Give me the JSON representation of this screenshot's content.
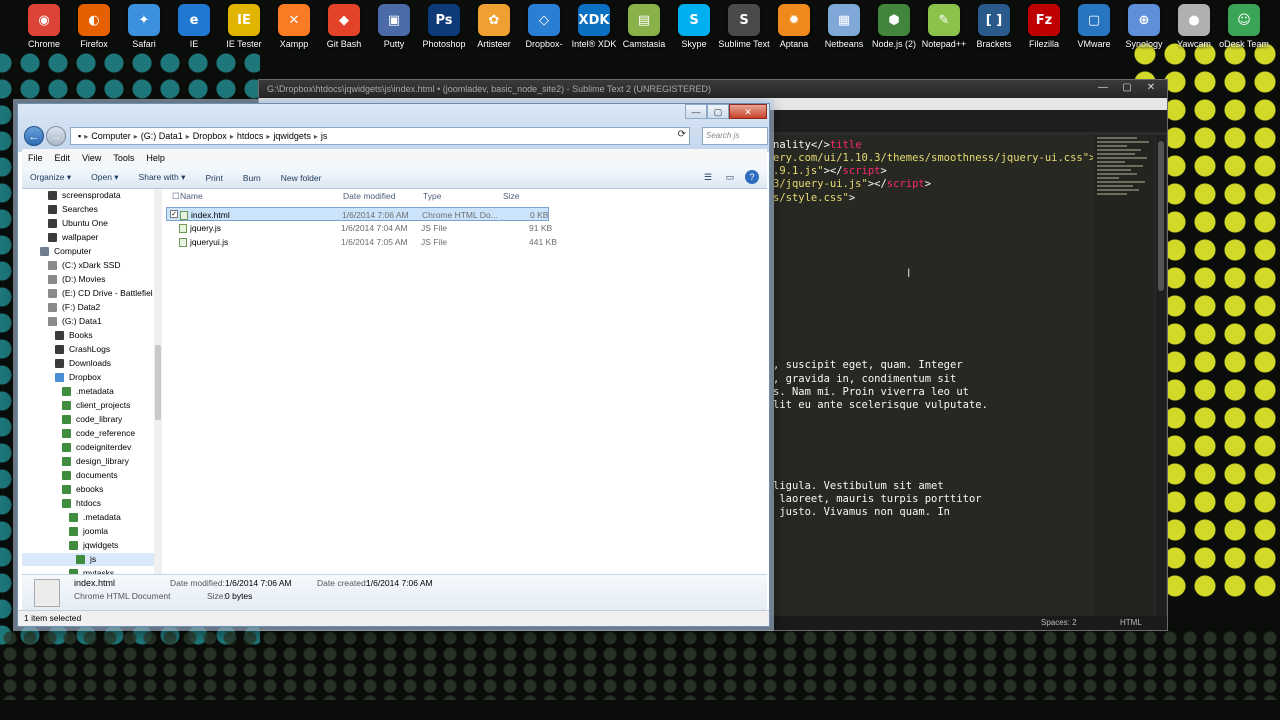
{
  "desktop_icons": [
    {
      "label": "Chrome",
      "icon": "chrome-icon",
      "color": "#db4437",
      "glyph": "◉"
    },
    {
      "label": "Firefox",
      "icon": "firefox-icon",
      "color": "#e66000",
      "glyph": "◐"
    },
    {
      "label": "Safari",
      "icon": "safari-icon",
      "color": "#3d8fe0",
      "glyph": "✦"
    },
    {
      "label": "IE",
      "icon": "ie-icon",
      "color": "#1f78d1",
      "glyph": "e"
    },
    {
      "label": "IE Tester",
      "icon": "ie-tester-icon",
      "color": "#e0b400",
      "glyph": "IE"
    },
    {
      "label": "Xampp",
      "icon": "xampp-icon",
      "color": "#fb7a24",
      "glyph": "✕"
    },
    {
      "label": "Git Bash",
      "icon": "git-bash-icon",
      "color": "#e24329",
      "glyph": "◆"
    },
    {
      "label": "Putty",
      "icon": "putty-icon",
      "color": "#4a6aa8",
      "glyph": "▣"
    },
    {
      "label": "Photoshop",
      "icon": "photoshop-icon",
      "color": "#0f3a78",
      "glyph": "Ps"
    },
    {
      "label": "Artisteer",
      "icon": "artisteer-icon",
      "color": "#f0a030",
      "glyph": "✿"
    },
    {
      "label": "Dropbox-",
      "icon": "dropbox-icon",
      "color": "#2a7fd4",
      "glyph": "◇"
    },
    {
      "label": "Intel® XDK",
      "icon": "intel-xdk-icon",
      "color": "#0b6fc2",
      "glyph": "XDK"
    },
    {
      "label": "Camstasia",
      "icon": "camtasia-icon",
      "color": "#8ab04a",
      "glyph": "▤"
    },
    {
      "label": "Skype",
      "icon": "skype-icon",
      "color": "#00aff0",
      "glyph": "S"
    },
    {
      "label": "Sublime Text",
      "icon": "sublime-icon",
      "color": "#4a4a4a",
      "glyph": "S"
    },
    {
      "label": "Aptana",
      "icon": "aptana-icon",
      "color": "#f08a1c",
      "glyph": "✹"
    },
    {
      "label": "Netbeans",
      "icon": "netbeans-icon",
      "color": "#7fa7d8",
      "glyph": "▦"
    },
    {
      "label": "Node.js (2)",
      "icon": "nodejs-icon",
      "color": "#43853d",
      "glyph": "⬢"
    },
    {
      "label": "Notepad++",
      "icon": "notepadpp-icon",
      "color": "#8bc34a",
      "glyph": "✎"
    },
    {
      "label": "Brackets",
      "icon": "brackets-icon",
      "color": "#2a5a8a",
      "glyph": "[ ]"
    },
    {
      "label": "Filezilla",
      "icon": "filezilla-icon",
      "color": "#bf0000",
      "glyph": "Fz"
    },
    {
      "label": "VMware",
      "icon": "vmware-icon",
      "color": "#2875c2",
      "glyph": "▢"
    },
    {
      "label": "Synology",
      "icon": "synology-icon",
      "color": "#5f8fd6",
      "glyph": "⊕"
    },
    {
      "label": "Yawcam",
      "icon": "yawcam-icon",
      "color": "#b0b0b0",
      "glyph": "●"
    },
    {
      "label": "oDesk Team",
      "icon": "odesk-icon",
      "color": "#3aa655",
      "glyph": "☺"
    }
  ],
  "sublime": {
    "title": "G:\\Dropbox\\htdocs\\jqwidgets\\js\\index.html • (joomladev, basic_node_site2) - Sublime Text 2 (UNREGISTERED)",
    "code_lines": [
      {
        "pre": "nality</",
        "tag": "title",
        "post": ">"
      },
      {
        "pre": "",
        "str": "ery.com/ui/1.10.3/themes/smoothness/jquery-ui.css\">",
        "post": ""
      },
      {
        "pre": "",
        "str": ".9.1.js\"",
        "post": "></",
        "tag": "script",
        "end": ">"
      },
      {
        "pre": "",
        "str": "3/jquery-ui.js\"",
        "post": "></",
        "tag": "script",
        "end": ">"
      },
      {
        "pre": "",
        "str": "s/style.css\"",
        "post": ">"
      },
      {
        "text": ", suscipit eget, quam. Integer"
      },
      {
        "text": ", gravida in, condimentum sit"
      },
      {
        "text": "s. Nam mi. Proin viverra leo ut"
      },
      {
        "text": "lit eu ante scelerisque vulputate."
      },
      {
        "text": "ligula. Vestibulum sit amet"
      },
      {
        "text": " laoreet, mauris turpis porttitor"
      },
      {
        "text": " justo. Vivamus non quam. In"
      }
    ],
    "status_spaces": "Spaces: 2",
    "status_syntax": "HTML"
  },
  "explorer": {
    "breadcrumb": [
      "Computer",
      "(G:) Data1",
      "Dropbox",
      "htdocs",
      "jqwidgets",
      "js"
    ],
    "search_placeholder": "Search js",
    "menu": [
      "File",
      "Edit",
      "View",
      "Tools",
      "Help"
    ],
    "commands": [
      "Organize ▾",
      "Open ▾",
      "Share with ▾",
      "Print",
      "Burn",
      "New folder"
    ],
    "nav_items": [
      {
        "label": "screensprodata",
        "indent": 0,
        "color": "#3b3b3b"
      },
      {
        "label": "Searches",
        "indent": 0,
        "color": "#3b3b3b"
      },
      {
        "label": "Ubuntu One",
        "indent": 0,
        "color": "#3b3b3b"
      },
      {
        "label": "wallpaper",
        "indent": 0,
        "color": "#3b3b3b"
      },
      {
        "label": "Computer",
        "indent": -8,
        "color": "#6f7f90"
      },
      {
        "label": "(C:) xDark SSD",
        "indent": 0,
        "color": "#8a8a8a"
      },
      {
        "label": "(D:) Movies",
        "indent": 0,
        "color": "#8a8a8a"
      },
      {
        "label": "(E:) CD Drive - Battlefiel",
        "indent": 0,
        "color": "#8a8a8a"
      },
      {
        "label": "(F:) Data2",
        "indent": 0,
        "color": "#8a8a8a"
      },
      {
        "label": "(G:) Data1",
        "indent": 0,
        "color": "#8a8a8a"
      },
      {
        "label": "Books",
        "indent": 7,
        "color": "#3b3b3b"
      },
      {
        "label": "CrashLogs",
        "indent": 7,
        "color": "#3b3b3b"
      },
      {
        "label": "Downloads",
        "indent": 7,
        "color": "#3b3b3b"
      },
      {
        "label": "Dropbox",
        "indent": 7,
        "color": "#4a8fd4"
      },
      {
        "label": ".metadata",
        "indent": 14,
        "color": "#3f8c3f"
      },
      {
        "label": "client_projects",
        "indent": 14,
        "color": "#3f8c3f"
      },
      {
        "label": "code_library",
        "indent": 14,
        "color": "#3f8c3f"
      },
      {
        "label": "code_reference",
        "indent": 14,
        "color": "#3f8c3f"
      },
      {
        "label": "codeigniterdev",
        "indent": 14,
        "color": "#3f8c3f"
      },
      {
        "label": "design_library",
        "indent": 14,
        "color": "#3f8c3f"
      },
      {
        "label": "documents",
        "indent": 14,
        "color": "#3f8c3f"
      },
      {
        "label": "ebooks",
        "indent": 14,
        "color": "#3f8c3f"
      },
      {
        "label": "htdocs",
        "indent": 14,
        "color": "#3f8c3f"
      },
      {
        "label": ".metadata",
        "indent": 21,
        "color": "#3f8c3f"
      },
      {
        "label": "joomla",
        "indent": 21,
        "color": "#3f8c3f"
      },
      {
        "label": "jqwidgets",
        "indent": 21,
        "color": "#3f8c3f"
      },
      {
        "label": "js",
        "indent": 28,
        "color": "#3f8c3f",
        "selected": true
      },
      {
        "label": "mytasks",
        "indent": 21,
        "color": "#3f8c3f"
      }
    ],
    "columns": {
      "name": "Name",
      "date": "Date modified",
      "type": "Type",
      "size": "Size"
    },
    "files": [
      {
        "name": "index.html",
        "date": "1/6/2014 7:06 AM",
        "type": "Chrome HTML Do...",
        "size": "0 KB",
        "selected": true
      },
      {
        "name": "jquery.js",
        "date": "1/6/2014 7:04 AM",
        "type": "JS File",
        "size": "91 KB"
      },
      {
        "name": "jqueryui.js",
        "date": "1/6/2014 7:05 AM",
        "type": "JS File",
        "size": "441 KB"
      }
    ],
    "details": {
      "name": "index.html",
      "kind": "Chrome HTML Document",
      "modified_label": "Date modified:",
      "modified_value": "1/6/2014 7:06 AM",
      "created_label": "Date created:",
      "created_value": "1/6/2014 7:06 AM",
      "size_label": "Size:",
      "size_value": "0 bytes"
    },
    "status": "1 item selected"
  }
}
